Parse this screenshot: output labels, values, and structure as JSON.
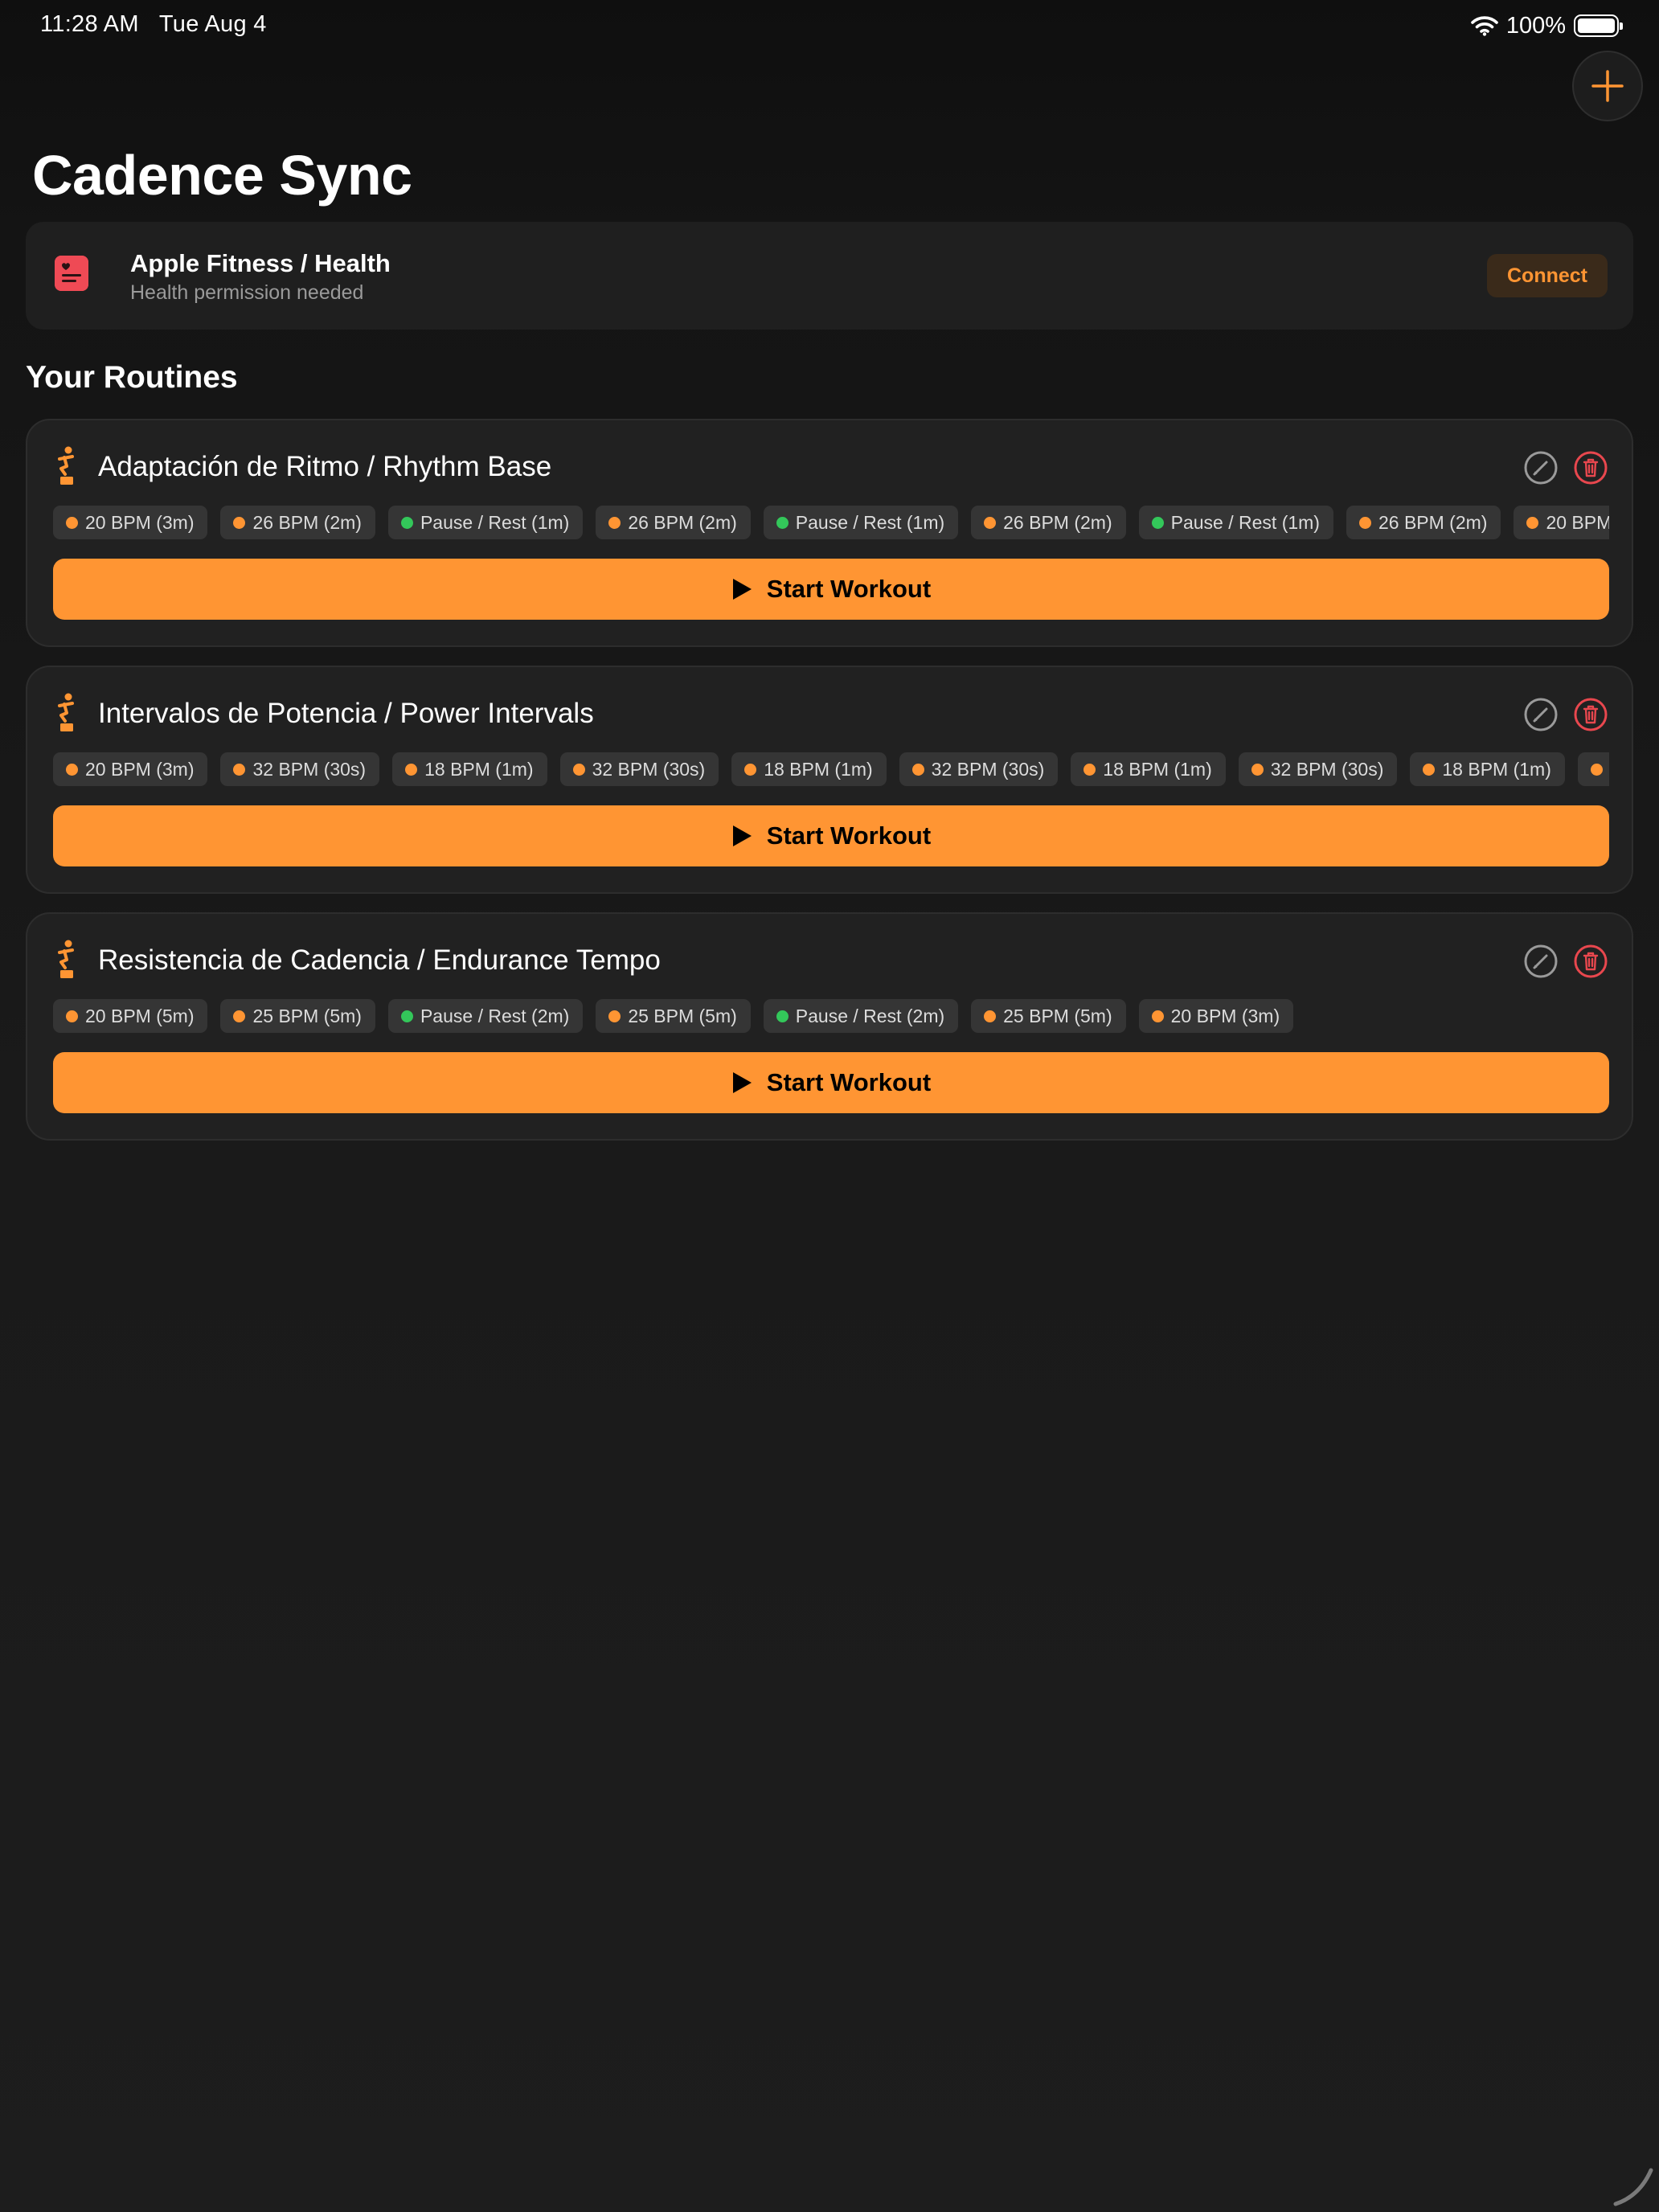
{
  "status_bar": {
    "time": "11:28 AM",
    "date": "Tue Aug 4",
    "battery": "100%"
  },
  "app": {
    "title": "Cadence Sync"
  },
  "health": {
    "title": "Apple Fitness / Health",
    "subtitle": "Health permission needed",
    "connect_label": "Connect"
  },
  "routines_section": {
    "title": "Your Routines"
  },
  "colors": {
    "accent": "#ff9533",
    "rest": "#33c75a",
    "danger": "#e8474e",
    "card": "#212121",
    "chip": "#353535"
  },
  "routines": [
    {
      "name": "Adaptación de Ritmo / Rhythm Base",
      "start_label": "Start Workout",
      "steps": [
        {
          "label": "20 BPM (3m)",
          "kind": "cadence"
        },
        {
          "label": "26 BPM (2m)",
          "kind": "cadence"
        },
        {
          "label": "Pause / Rest (1m)",
          "kind": "rest"
        },
        {
          "label": "26 BPM (2m)",
          "kind": "cadence"
        },
        {
          "label": "Pause / Rest (1m)",
          "kind": "rest"
        },
        {
          "label": "26 BPM (2m)",
          "kind": "cadence"
        },
        {
          "label": "Pause / Rest (1m)",
          "kind": "rest"
        },
        {
          "label": "26 BPM (2m)",
          "kind": "cadence"
        },
        {
          "label": "20 BPM",
          "kind": "cadence"
        }
      ]
    },
    {
      "name": "Intervalos de Potencia / Power Intervals",
      "start_label": "Start Workout",
      "steps": [
        {
          "label": "20 BPM (3m)",
          "kind": "cadence"
        },
        {
          "label": "32 BPM (30s)",
          "kind": "cadence"
        },
        {
          "label": "18 BPM (1m)",
          "kind": "cadence"
        },
        {
          "label": "32 BPM (30s)",
          "kind": "cadence"
        },
        {
          "label": "18 BPM (1m)",
          "kind": "cadence"
        },
        {
          "label": "32 BPM (30s)",
          "kind": "cadence"
        },
        {
          "label": "18 BPM (1m)",
          "kind": "cadence"
        },
        {
          "label": "32 BPM (30s)",
          "kind": "cadence"
        },
        {
          "label": "18 BPM (1m)",
          "kind": "cadence"
        },
        {
          "label": "",
          "kind": "cadence"
        }
      ]
    },
    {
      "name": "Resistencia de Cadencia / Endurance Tempo",
      "start_label": "Start Workout",
      "steps": [
        {
          "label": "20 BPM (5m)",
          "kind": "cadence"
        },
        {
          "label": "25 BPM (5m)",
          "kind": "cadence"
        },
        {
          "label": "Pause / Rest (2m)",
          "kind": "rest"
        },
        {
          "label": "25 BPM (5m)",
          "kind": "cadence"
        },
        {
          "label": "Pause / Rest (2m)",
          "kind": "rest"
        },
        {
          "label": "25 BPM (5m)",
          "kind": "cadence"
        },
        {
          "label": "20 BPM (3m)",
          "kind": "cadence"
        }
      ]
    }
  ]
}
